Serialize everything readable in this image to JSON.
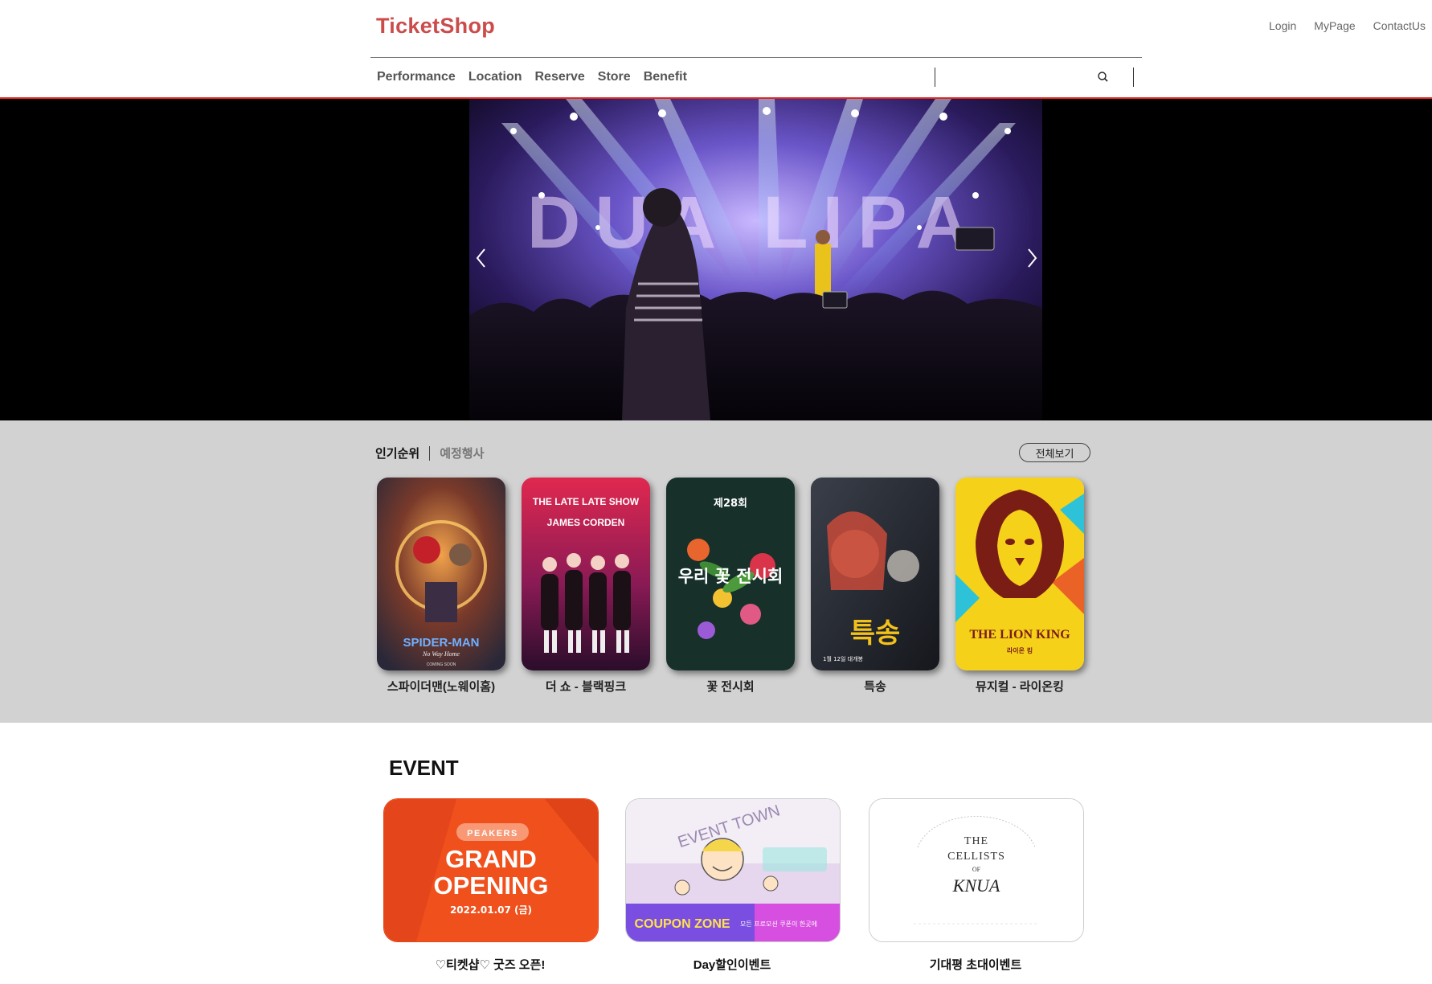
{
  "header": {
    "logo": "TicketShop",
    "util_links": [
      "Login",
      "MyPage",
      "ContactUs"
    ],
    "nav": [
      "Performance",
      "Location",
      "Reserve",
      "Store",
      "Benefit"
    ],
    "search": {
      "placeholder": "",
      "value": ""
    }
  },
  "hero": {
    "marquee_text": "DUA LIPA"
  },
  "ranking": {
    "tabs": [
      "인기순위",
      "예정행사"
    ],
    "view_all": "전체보기",
    "items": [
      {
        "title": "스파이더맨(노웨이홈)",
        "poster_text": "SPIDER-MAN",
        "poster_sub": "No Way Home",
        "poster_footer": "COMING SOON"
      },
      {
        "title": "더 쇼 - 블랙핑크",
        "poster_text": "THE LATE LATE SHOW",
        "poster_sub": "JAMES CORDEN"
      },
      {
        "title": "꽃 전시회",
        "poster_text": "제28회",
        "poster_sub": "우리 꽃 전시회"
      },
      {
        "title": "특송",
        "poster_text": "특송",
        "poster_sub": "1월 12일 대개봉"
      },
      {
        "title": "뮤지컬 - 라이온킹",
        "poster_text": "THE LION KING",
        "poster_sub": "라이온 킹"
      }
    ]
  },
  "events": {
    "heading": "EVENT",
    "items": [
      {
        "title": "♡티켓샵♡ 굿즈 오픈!",
        "brand": "PEAKERS",
        "line1": "GRAND",
        "line2": "OPENING",
        "date": "2022.01.07 (금)"
      },
      {
        "title": "Day할인이벤트",
        "banner_top": "EVENT TOWN",
        "banner_zone": "COUPON ZONE",
        "banner_note": "모든 프로모션 쿠폰이 한곳에"
      },
      {
        "title": "기대평 초대이벤트",
        "line1": "THE",
        "line2": "CELLISTS",
        "line3": "OF",
        "line4": "KNUA"
      }
    ]
  }
}
